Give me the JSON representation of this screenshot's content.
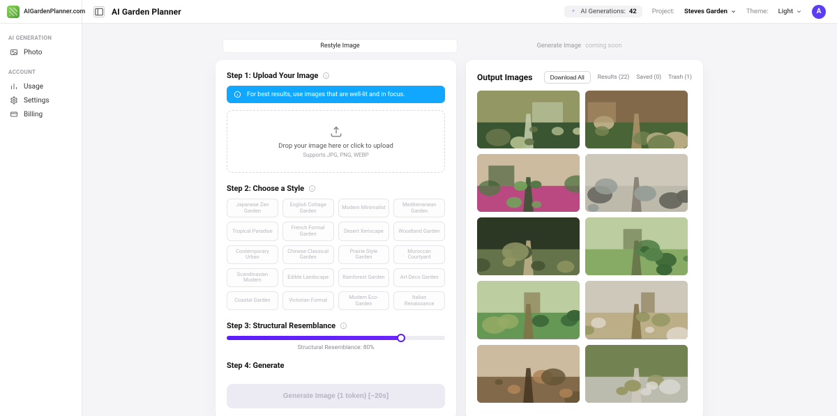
{
  "site_name": "AIGardenPlanner.com",
  "app_title": "AI Garden Planner",
  "header": {
    "generations_label": "AI Generations:",
    "generations_count": "42",
    "project_label": "Project:",
    "project_name": "Steves Garden",
    "theme_label": "Theme:",
    "theme_value": "Light",
    "avatar_initial": "A"
  },
  "sidebar": {
    "group1_heading": "AI GENERATION",
    "item_photo": "Photo",
    "group2_heading": "ACCOUNT",
    "item_usage": "Usage",
    "item_settings": "Settings",
    "item_billing": "Billing"
  },
  "tabs": {
    "restyle": "Restyle Image",
    "generate": "Generate Image",
    "soon": "coming soon"
  },
  "left": {
    "step1_title": "Step 1: Upload Your Image",
    "note": "For best results, use images that are well-lit and in focus.",
    "dz_main": "Drop your image here or click to upload",
    "dz_sub": "Supports JPG, PNG, WEBP",
    "step2_title": "Step 2: Choose a Style",
    "styles": [
      "Japanese Zen Garden",
      "English Cottage Garden",
      "Modern Minimalist",
      "Mediterranean Garden",
      "Tropical Paradise",
      "French Formal Garden",
      "Desert Xeriscape",
      "Woodland Garden",
      "Contemporary Urban",
      "Chinese Classical Garden",
      "Prairie Style Garden",
      "Moroccan Courtyard",
      "Scandinavian Modern",
      "Edible Landscape",
      "Rainforest Garden",
      "Art Deco Garden",
      "Coastal Garden",
      "Victorian Formal",
      "Modern Eco-Garden",
      "Italian Renaissance"
    ],
    "step3_title": "Step 3: Structural Resemblance",
    "slider_caption": "Structural Resemblance: 80%",
    "slider_value_pct": 80,
    "step4_title": "Step 4: Generate",
    "generate_btn": "Generate Image (1 token) [~20s]"
  },
  "right": {
    "title": "Output Images",
    "download_all": "Download All",
    "results_label": "Results (22)",
    "saved_label": "Saved (0)",
    "trash_label": "Trash (1)"
  }
}
